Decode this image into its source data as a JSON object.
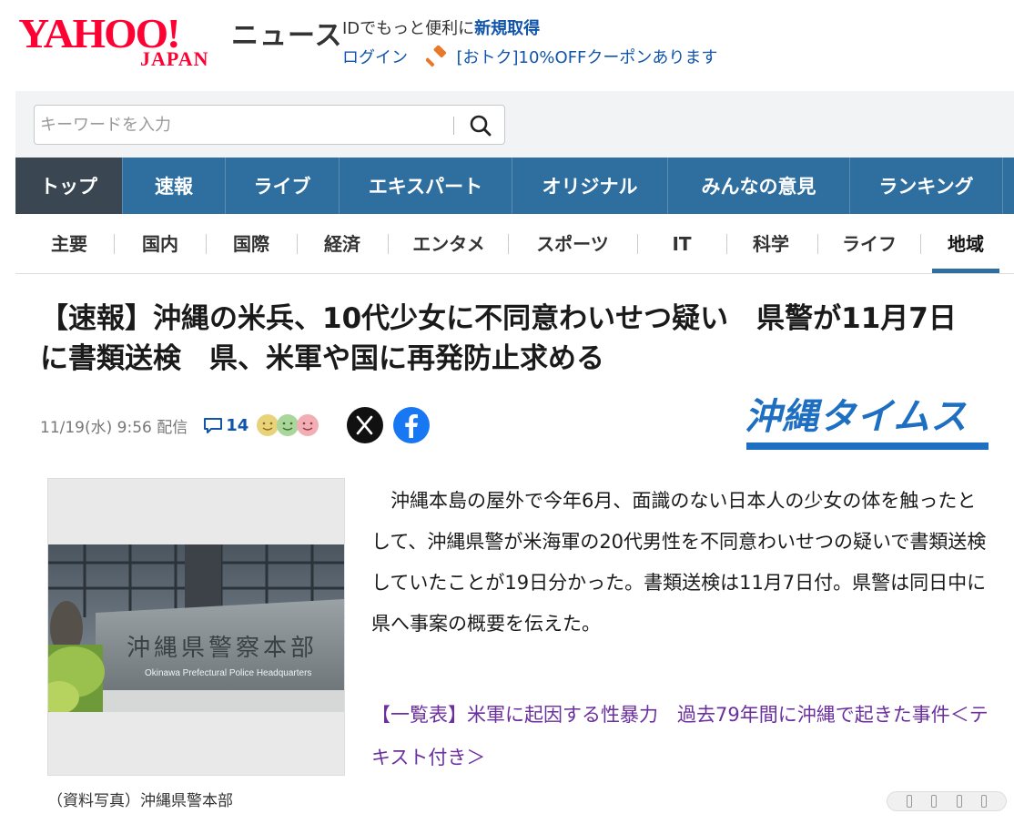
{
  "header": {
    "logo_main": "YAHOO!",
    "logo_sub": "JAPAN",
    "service_name": "ニュース",
    "id_prompt": "IDでもっと便利に",
    "signup_label": "新規取得",
    "login_label": "ログイン",
    "coupon_text": "[おトク]10%OFFクーポンあります"
  },
  "search": {
    "placeholder": "キーワードを入力"
  },
  "main_nav": [
    {
      "label": "トップ",
      "active": true
    },
    {
      "label": "速報"
    },
    {
      "label": "ライブ"
    },
    {
      "label": "エキスパート"
    },
    {
      "label": "オリジナル"
    },
    {
      "label": "みんなの意見"
    },
    {
      "label": "ランキング"
    }
  ],
  "sub_nav": [
    {
      "label": "主要"
    },
    {
      "label": "国内"
    },
    {
      "label": "国際"
    },
    {
      "label": "経済"
    },
    {
      "label": "エンタメ"
    },
    {
      "label": "スポーツ"
    },
    {
      "label": "IT"
    },
    {
      "label": "科学"
    },
    {
      "label": "ライフ"
    },
    {
      "label": "地域",
      "active": true
    }
  ],
  "article": {
    "headline_line1": "【速報】沖縄の米兵、10代少女に不同意わいせつ疑い　県警が11月7日",
    "headline_line2": "に書類送検　県、米軍や国に再発防止求める",
    "date": "11/19(水) 9:56 配信",
    "comment_count": "14",
    "source_name": "沖縄タイムス",
    "photo_sign_jp": "沖縄県警察本部",
    "photo_sign_en": "Okinawa Prefectural Police Headquarters",
    "photo_caption": "（資料写真）沖縄県警本部",
    "body": "沖縄本島の屋外で今年6月、面識のない日本人の少女の体を触ったとして、沖縄県警が米海軍の20代男性を不同意わいせつの疑いで書類送検していたことが19日分かった。書類送検は11月7日付。県警は同日中に県へ事案の概要を伝えた。",
    "related_link": "【一覧表】米軍に起因する性暴力　過去79年間に沖縄で起きた事件＜テキスト付き＞"
  },
  "colors": {
    "brand_red": "#ff0033",
    "nav_blue": "#2f6fa0",
    "nav_active": "#3a4652",
    "link_blue": "#1155aa",
    "related_purple": "#6b2f9e",
    "source_blue": "#1e6fc1"
  }
}
